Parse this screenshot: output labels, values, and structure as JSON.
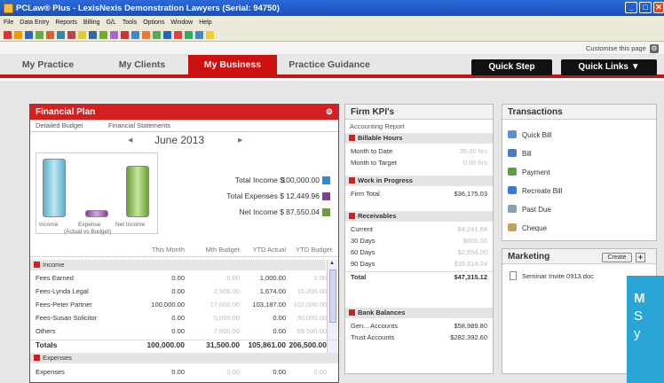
{
  "window": {
    "title": "PCLaw® Plus - LexisNexis Demonstration Lawyers (Serial: 94750)"
  },
  "menu": [
    "File",
    "Data Entry",
    "Reports",
    "Billing",
    "G/L",
    "Tools",
    "Options",
    "Window",
    "Help"
  ],
  "customise": "Customise this page",
  "tabs": [
    "My Practice",
    "My Clients",
    "My Business",
    "Practice Guidance"
  ],
  "buttons": {
    "quick_step": "Quick Step",
    "quick_links": "Quick Links ▼"
  },
  "financial_plan": {
    "title": "Financial Plan",
    "subtabs": [
      "Detailed Budget",
      "Financial Statements"
    ],
    "month": "June 2013",
    "bar_labels": [
      "Income",
      "Expense",
      "Net Income"
    ],
    "bar_sub": "(Actual vs Budget)",
    "bar_levels": [
      1.0,
      0.125,
      0.876
    ],
    "totals": [
      {
        "label": "Total Income $",
        "value": "100,000.00"
      },
      {
        "label": "Total Expenses $",
        "value": "12,449.96"
      },
      {
        "label": "Net Income $",
        "value": "87,550.04"
      }
    ],
    "columns": [
      "This Month",
      "Mth Budget",
      "YTD Actual",
      "YTD Budget"
    ],
    "income_header": "Income",
    "rows": [
      {
        "name": "Fees Earned",
        "v": [
          "0.00",
          "0.00",
          "1,000.00",
          "0.00"
        ]
      },
      {
        "name": "Fees-Lynda Legal",
        "v": [
          "0.00",
          "2,500.00",
          "1,674.00",
          "15,000.00"
        ]
      },
      {
        "name": "Fees-Peter Partner",
        "v": [
          "100,000.00",
          "17,000.00",
          "103,187.00",
          "102,000.00"
        ]
      },
      {
        "name": "Fees-Susan Solicitor",
        "v": [
          "0.00",
          "5,000.00",
          "0.00",
          "30,000.00"
        ]
      },
      {
        "name": "Others",
        "v": [
          "0.00",
          "7,000.00",
          "0.00",
          "59,500.00"
        ]
      }
    ],
    "totals_row": {
      "name": "Totals",
      "v": [
        "100,000.00",
        "31,500.00",
        "105,861.00",
        "206,500.00"
      ]
    },
    "expenses_header": "Expenses",
    "expense_row": {
      "name": "Expenses",
      "v": [
        "0.00",
        "0.00",
        "0.00",
        "0.00"
      ]
    }
  },
  "kpi": {
    "title": "Firm KPI's",
    "report": "Accounting Report",
    "billable": {
      "header": "Billable Hours",
      "rows": [
        {
          "l": "Month to Date",
          "v": "38.00 hrs"
        },
        {
          "l": "Month to Target",
          "v": "0.00 hrs"
        }
      ]
    },
    "wip": {
      "header": "Work in Progress",
      "rows": [
        {
          "l": "Firm Total",
          "v": "$36,175.03"
        }
      ]
    },
    "receivables": {
      "header": "Receivables",
      "rows": [
        {
          "l": "Current",
          "v": "$4,241.68"
        },
        {
          "l": "30 Days",
          "v": "$605.00"
        },
        {
          "l": "60 Days",
          "v": "$2,654.00"
        },
        {
          "l": "90 Days",
          "v": "$39,814.24"
        }
      ],
      "total_label": "Total",
      "total": "$47,315.12"
    },
    "bank": {
      "header": "Bank Balances",
      "rows": [
        {
          "l": "Gen... Accounts",
          "v": "$58,989.80"
        },
        {
          "l": "Trust Accounts",
          "v": "$282,392.60"
        }
      ]
    }
  },
  "transactions": {
    "title": "Transactions",
    "items": [
      "Quick Bill",
      "Bill",
      "Payment",
      "Recreate Bill",
      "Past Due",
      "Cheque"
    ]
  },
  "marketing": {
    "title": "Marketing",
    "create": "Create",
    "doc": "Seminar Invite 0913.doc"
  },
  "promo": [
    "M",
    "S",
    "y"
  ]
}
